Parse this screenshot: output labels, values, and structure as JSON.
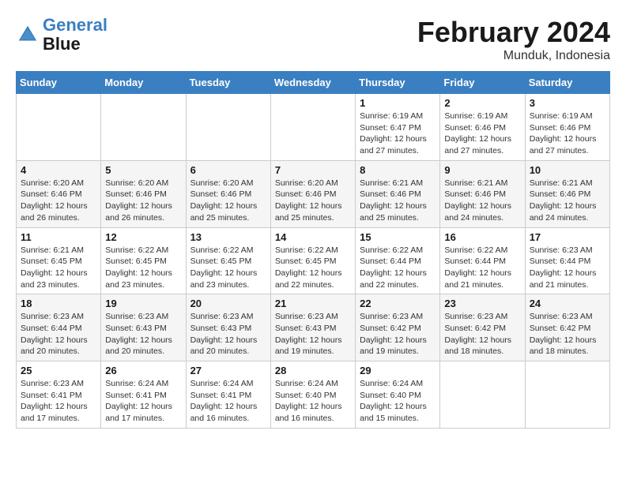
{
  "header": {
    "logo_line1": "General",
    "logo_line2": "Blue",
    "month_title": "February 2024",
    "location": "Munduk, Indonesia"
  },
  "weekdays": [
    "Sunday",
    "Monday",
    "Tuesday",
    "Wednesday",
    "Thursday",
    "Friday",
    "Saturday"
  ],
  "weeks": [
    [
      {
        "day": "",
        "info": ""
      },
      {
        "day": "",
        "info": ""
      },
      {
        "day": "",
        "info": ""
      },
      {
        "day": "",
        "info": ""
      },
      {
        "day": "1",
        "info": "Sunrise: 6:19 AM\nSunset: 6:47 PM\nDaylight: 12 hours\nand 27 minutes."
      },
      {
        "day": "2",
        "info": "Sunrise: 6:19 AM\nSunset: 6:46 PM\nDaylight: 12 hours\nand 27 minutes."
      },
      {
        "day": "3",
        "info": "Sunrise: 6:19 AM\nSunset: 6:46 PM\nDaylight: 12 hours\nand 27 minutes."
      }
    ],
    [
      {
        "day": "4",
        "info": "Sunrise: 6:20 AM\nSunset: 6:46 PM\nDaylight: 12 hours\nand 26 minutes."
      },
      {
        "day": "5",
        "info": "Sunrise: 6:20 AM\nSunset: 6:46 PM\nDaylight: 12 hours\nand 26 minutes."
      },
      {
        "day": "6",
        "info": "Sunrise: 6:20 AM\nSunset: 6:46 PM\nDaylight: 12 hours\nand 25 minutes."
      },
      {
        "day": "7",
        "info": "Sunrise: 6:20 AM\nSunset: 6:46 PM\nDaylight: 12 hours\nand 25 minutes."
      },
      {
        "day": "8",
        "info": "Sunrise: 6:21 AM\nSunset: 6:46 PM\nDaylight: 12 hours\nand 25 minutes."
      },
      {
        "day": "9",
        "info": "Sunrise: 6:21 AM\nSunset: 6:46 PM\nDaylight: 12 hours\nand 24 minutes."
      },
      {
        "day": "10",
        "info": "Sunrise: 6:21 AM\nSunset: 6:46 PM\nDaylight: 12 hours\nand 24 minutes."
      }
    ],
    [
      {
        "day": "11",
        "info": "Sunrise: 6:21 AM\nSunset: 6:45 PM\nDaylight: 12 hours\nand 23 minutes."
      },
      {
        "day": "12",
        "info": "Sunrise: 6:22 AM\nSunset: 6:45 PM\nDaylight: 12 hours\nand 23 minutes."
      },
      {
        "day": "13",
        "info": "Sunrise: 6:22 AM\nSunset: 6:45 PM\nDaylight: 12 hours\nand 23 minutes."
      },
      {
        "day": "14",
        "info": "Sunrise: 6:22 AM\nSunset: 6:45 PM\nDaylight: 12 hours\nand 22 minutes."
      },
      {
        "day": "15",
        "info": "Sunrise: 6:22 AM\nSunset: 6:44 PM\nDaylight: 12 hours\nand 22 minutes."
      },
      {
        "day": "16",
        "info": "Sunrise: 6:22 AM\nSunset: 6:44 PM\nDaylight: 12 hours\nand 21 minutes."
      },
      {
        "day": "17",
        "info": "Sunrise: 6:23 AM\nSunset: 6:44 PM\nDaylight: 12 hours\nand 21 minutes."
      }
    ],
    [
      {
        "day": "18",
        "info": "Sunrise: 6:23 AM\nSunset: 6:44 PM\nDaylight: 12 hours\nand 20 minutes."
      },
      {
        "day": "19",
        "info": "Sunrise: 6:23 AM\nSunset: 6:43 PM\nDaylight: 12 hours\nand 20 minutes."
      },
      {
        "day": "20",
        "info": "Sunrise: 6:23 AM\nSunset: 6:43 PM\nDaylight: 12 hours\nand 20 minutes."
      },
      {
        "day": "21",
        "info": "Sunrise: 6:23 AM\nSunset: 6:43 PM\nDaylight: 12 hours\nand 19 minutes."
      },
      {
        "day": "22",
        "info": "Sunrise: 6:23 AM\nSunset: 6:42 PM\nDaylight: 12 hours\nand 19 minutes."
      },
      {
        "day": "23",
        "info": "Sunrise: 6:23 AM\nSunset: 6:42 PM\nDaylight: 12 hours\nand 18 minutes."
      },
      {
        "day": "24",
        "info": "Sunrise: 6:23 AM\nSunset: 6:42 PM\nDaylight: 12 hours\nand 18 minutes."
      }
    ],
    [
      {
        "day": "25",
        "info": "Sunrise: 6:23 AM\nSunset: 6:41 PM\nDaylight: 12 hours\nand 17 minutes."
      },
      {
        "day": "26",
        "info": "Sunrise: 6:24 AM\nSunset: 6:41 PM\nDaylight: 12 hours\nand 17 minutes."
      },
      {
        "day": "27",
        "info": "Sunrise: 6:24 AM\nSunset: 6:41 PM\nDaylight: 12 hours\nand 16 minutes."
      },
      {
        "day": "28",
        "info": "Sunrise: 6:24 AM\nSunset: 6:40 PM\nDaylight: 12 hours\nand 16 minutes."
      },
      {
        "day": "29",
        "info": "Sunrise: 6:24 AM\nSunset: 6:40 PM\nDaylight: 12 hours\nand 15 minutes."
      },
      {
        "day": "",
        "info": ""
      },
      {
        "day": "",
        "info": ""
      }
    ]
  ]
}
